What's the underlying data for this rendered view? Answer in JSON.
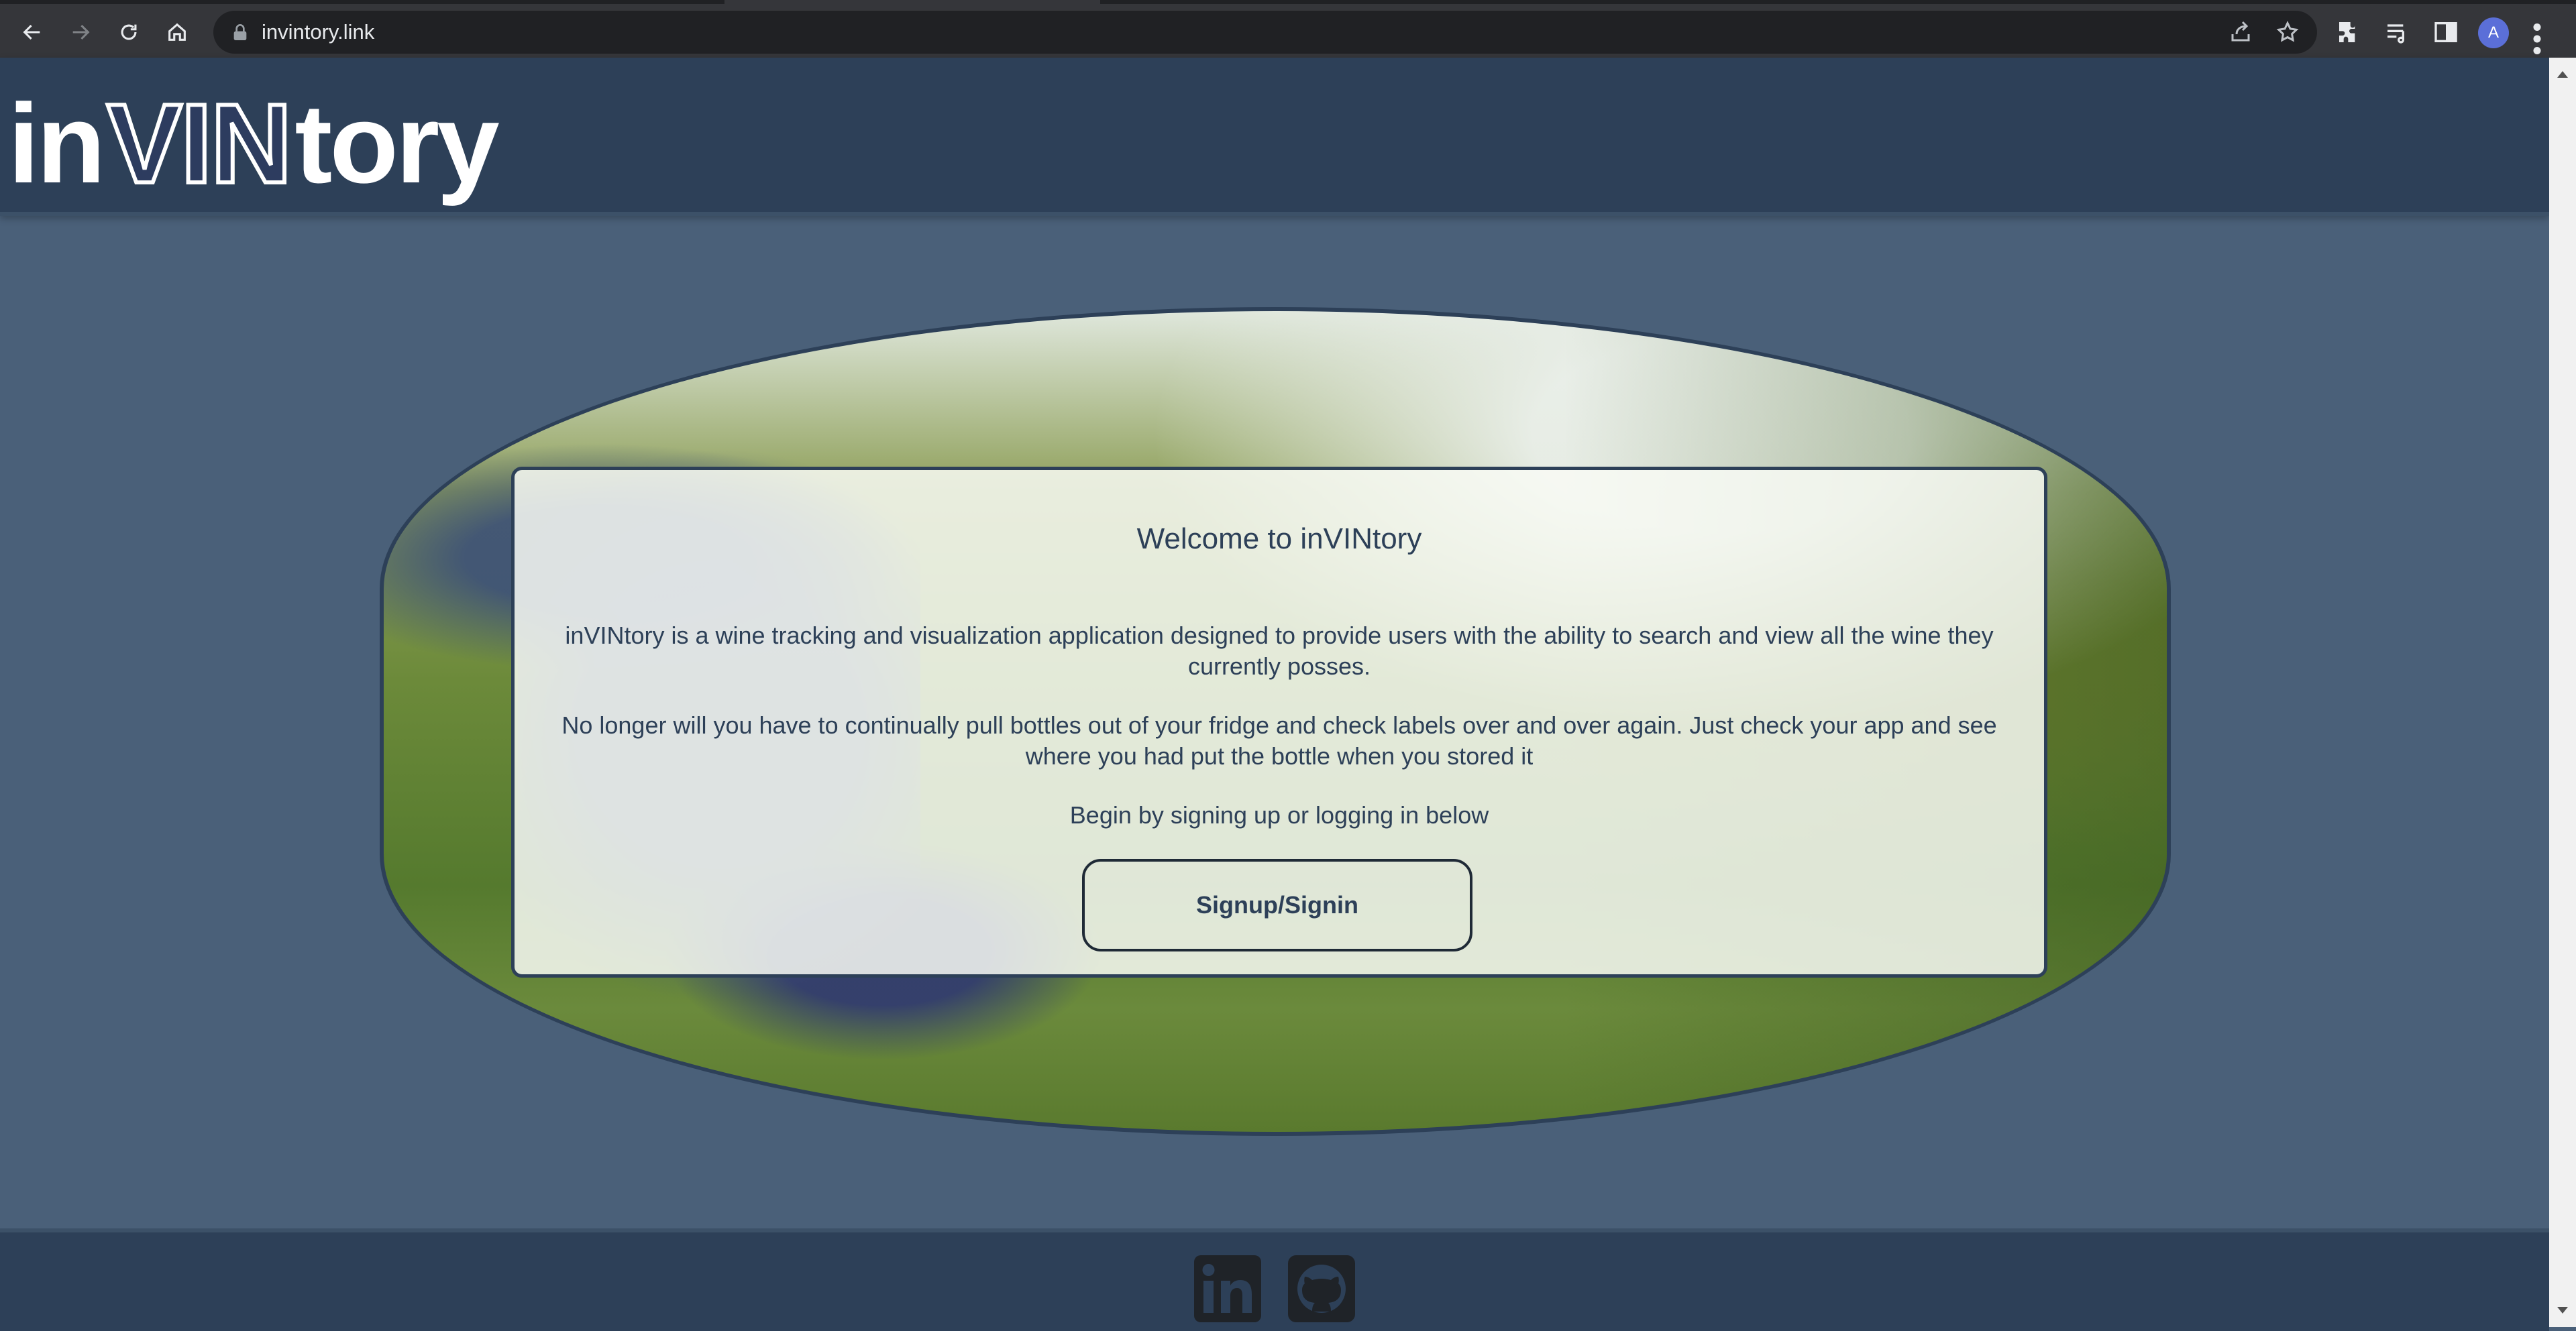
{
  "browser": {
    "url": "invintory.link",
    "avatar_letter": "A"
  },
  "header": {
    "logo_prefix": "in",
    "logo_vin": "VIN",
    "logo_suffix": "tory"
  },
  "card": {
    "title": "Welcome to inVINtory",
    "paragraph1": "inVINtory is a wine tracking and visualization application designed to provide users with the ability to search and view all the wine they currently posses.",
    "paragraph2": "No longer will you have to continually pull bottles out of your fridge and check labels over and over again. Just check your app and see where you had put the bottle when you stored it",
    "paragraph3": "Begin by signing up or logging in below",
    "button_label": "Signup/Signin"
  },
  "footer": {
    "icons": [
      "linkedin-icon",
      "github-icon"
    ]
  },
  "colors": {
    "page_bg": "#4a6079",
    "header_bg": "#2d4058",
    "text_dark": "#2d4058"
  }
}
